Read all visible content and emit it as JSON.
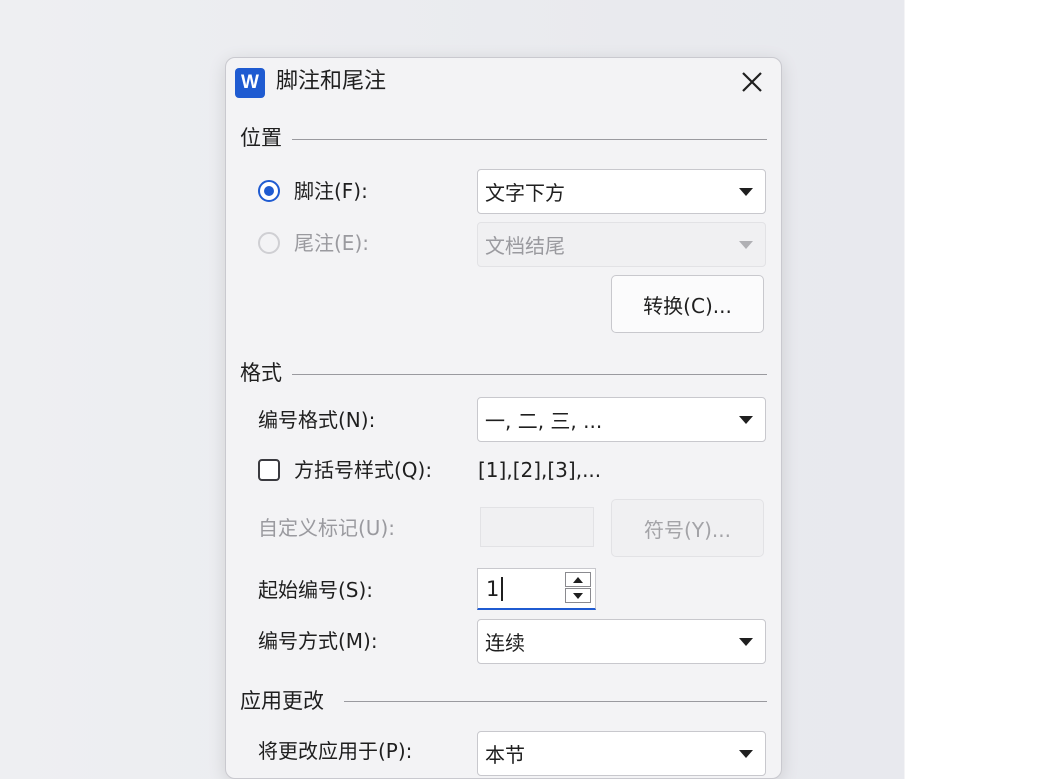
{
  "title": "脚注和尾注",
  "logo_letter": "W",
  "position": {
    "section_label": "位置",
    "footnote_label": "脚注(F):",
    "footnote_selected": true,
    "footnote_location": "文字下方",
    "endnote_label": "尾注(E):",
    "endnote_location": "文档结尾",
    "convert_button": "转换(C)..."
  },
  "format": {
    "section_label": "格式",
    "number_format_label": "编号格式(N):",
    "number_format_value": "一, 二, 三, ...",
    "bracket_style_label": "方括号样式(Q):",
    "bracket_style_checked": false,
    "bracket_style_example": "[1],[2],[3],...",
    "custom_mark_label": "自定义标记(U):",
    "custom_mark_value": "",
    "symbol_button": "符号(Y)...",
    "start_at_label": "起始编号(S):",
    "start_at_value": "1",
    "numbering_label": "编号方式(M):",
    "numbering_value": "连续"
  },
  "apply": {
    "section_label": "应用更改",
    "apply_to_label": "将更改应用于(P):",
    "apply_to_value": "本节"
  },
  "colors": {
    "accent": "#1f5bd1",
    "dialog_bg": "#f3f3f5",
    "disabled_text": "#9a9a9f"
  }
}
